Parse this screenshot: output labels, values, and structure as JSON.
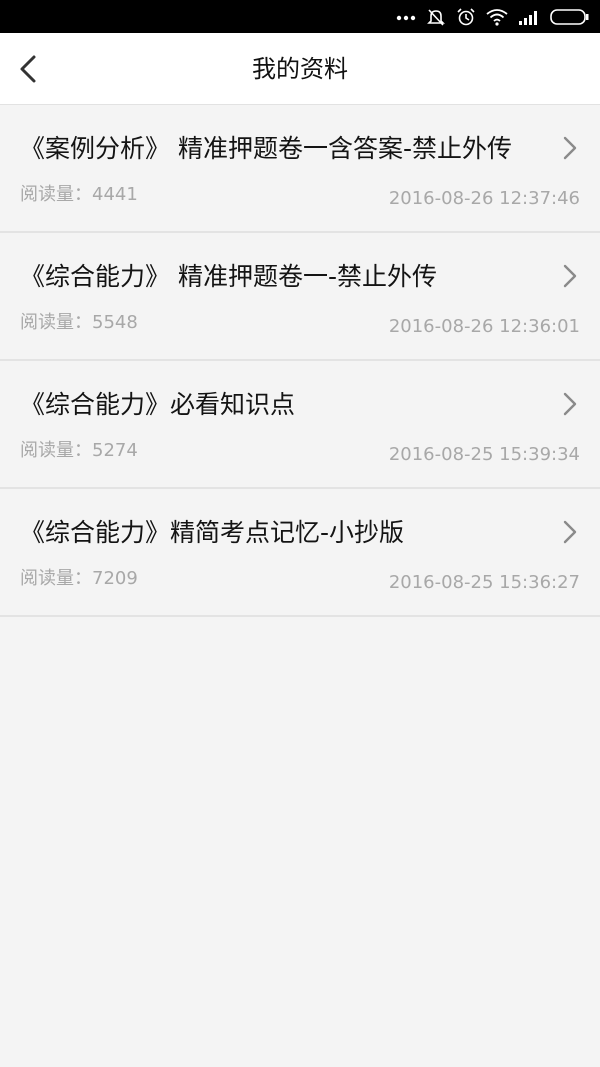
{
  "status_bar": {
    "icons": [
      "more-dots-icon",
      "notifications-off-icon",
      "alarm-icon",
      "wifi-icon",
      "signal-icon",
      "battery-icon"
    ]
  },
  "header": {
    "title": "我的资料",
    "back_icon": "chevron-left-icon"
  },
  "list": {
    "read_label": "阅读量：",
    "items": [
      {
        "title": "《案例分析》 精准押题卷一含答案-禁止外传",
        "reads": "4441",
        "date": "2016-08-26 12:37:46"
      },
      {
        "title": "《综合能力》 精准押题卷一-禁止外传",
        "reads": "5548",
        "date": "2016-08-26 12:36:01"
      },
      {
        "title": "《综合能力》必看知识点",
        "reads": "5274",
        "date": "2016-08-25 15:39:34"
      },
      {
        "title": "《综合能力》精简考点记忆-小抄版",
        "reads": "7209",
        "date": "2016-08-25 15:36:27"
      }
    ]
  },
  "colors": {
    "status_bar": "#000000",
    "header_bg": "#ffffff",
    "page_bg": "#f4f4f4",
    "title_text": "#141414",
    "meta_text": "#a8a8a8",
    "divider": "#e3e3e3",
    "chevron": "#8a8a8a"
  }
}
